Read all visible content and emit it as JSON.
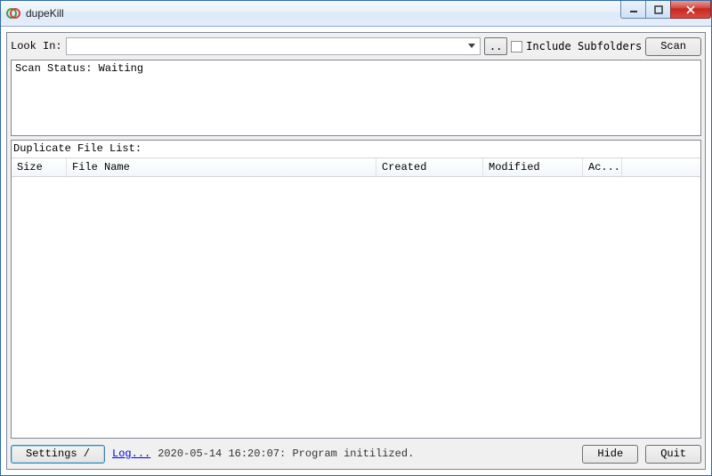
{
  "window": {
    "title": "dupeKill"
  },
  "toolbar": {
    "look_in_label": "Look In:",
    "look_in_value": "",
    "browse_label": "..",
    "include_subfolders_label": "Include Subfolders",
    "scan_label": "Scan"
  },
  "status": {
    "text": "Scan Status: Waiting"
  },
  "list": {
    "caption": "Duplicate File List:",
    "columns": {
      "size": "Size",
      "name": "File Name",
      "created": "Created",
      "modified": "Modified",
      "action": "Ac..."
    },
    "rows": []
  },
  "footer": {
    "settings_label": "Settings /",
    "log_link": "Log...",
    "log_text": "2020-05-14 16:20:07: Program initilized.",
    "hide_label": "Hide",
    "quit_label": "Quit"
  }
}
